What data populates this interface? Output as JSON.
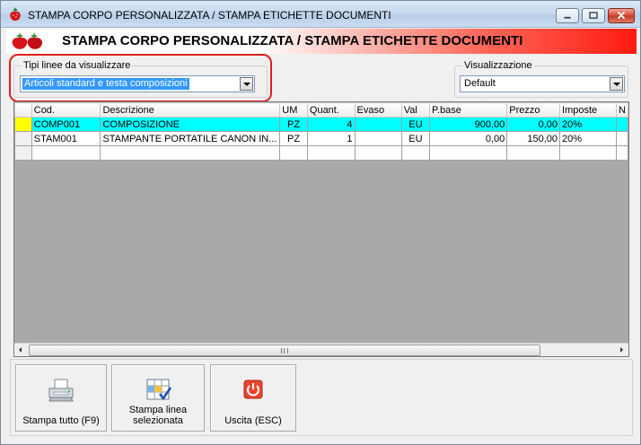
{
  "window": {
    "title": "STAMPA CORPO PERSONALIZZATA / STAMPA ETICHETTE DOCUMENTI"
  },
  "header": {
    "title": "STAMPA CORPO PERSONALIZZATA / STAMPA ETICHETTE DOCUMENTI"
  },
  "filters": {
    "line_types": {
      "label": "Tipi linee da visualizzare",
      "value": "Articoli standard e testa composizioni"
    },
    "view": {
      "label": "Visualizzazione",
      "value": "Default"
    }
  },
  "grid": {
    "columns": [
      "Cod.",
      "Descrizione",
      "UM",
      "Quant.",
      "Evaso",
      "Val",
      "P.base",
      "Prezzo",
      "Imposte",
      "N"
    ],
    "rows": [
      {
        "cod": "COMP001",
        "descrizione": "COMPOSIZIONE",
        "um": "PZ",
        "quant": "4",
        "evaso": "",
        "val": "EU",
        "pbase": "900,00",
        "prezzo": "0,00",
        "imposte": "20%",
        "n": ""
      },
      {
        "cod": "STAM001",
        "descrizione": "STAMPANTE PORTATILE CANON IN...",
        "um": "PZ",
        "quant": "1",
        "evaso": "",
        "val": "EU",
        "pbase": "0,00",
        "prezzo": "150,00",
        "imposte": "20%",
        "n": ""
      }
    ]
  },
  "toolbar": {
    "print_all": "Stampa tutto (F9)",
    "print_selected_line1": "Stampa linea",
    "print_selected_line2": "selezionata",
    "exit": "Uscita (ESC)"
  },
  "icons": {
    "app": "strawberry-icon",
    "print_all": "printer-icon",
    "print_selected": "checklist-grid-icon",
    "exit": "power-off-icon"
  },
  "colors": {
    "selected_row": "#00ffff",
    "row_indicator": "#ffff00",
    "header_red": "#ff1a10",
    "highlight": "#e02020"
  }
}
